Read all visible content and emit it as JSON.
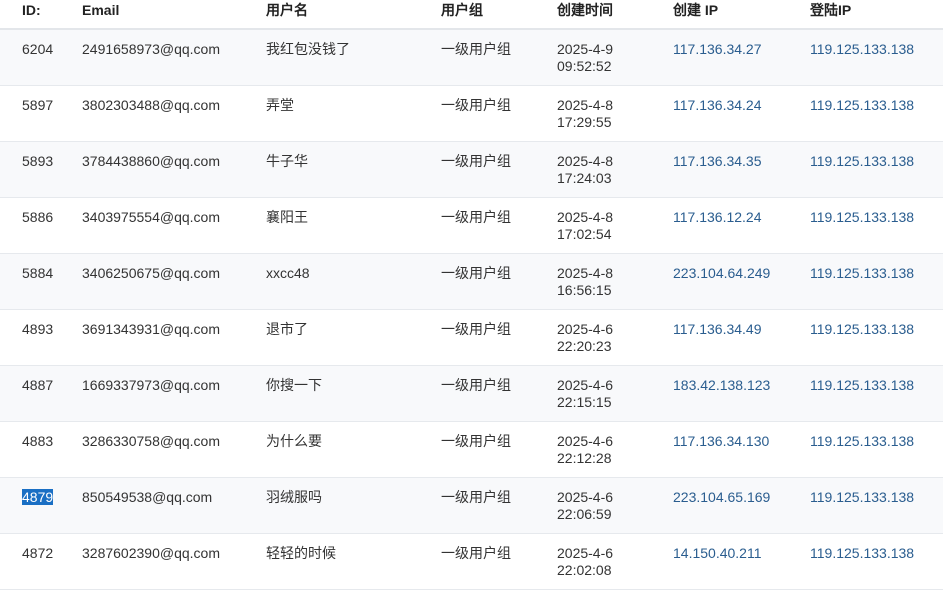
{
  "table": {
    "headers": {
      "id": "ID:",
      "email": "Email",
      "username": "用户名",
      "group": "用户组",
      "created_time": "创建时间",
      "created_ip": "创建 IP",
      "login_ip": "登陆IP"
    },
    "rows": [
      {
        "id": "6204",
        "email": "2491658973@qq.com",
        "username": "我红包没钱了",
        "group": "一级用户组",
        "date": "2025-4-9",
        "time": "09:52:52",
        "created_ip": "117.136.34.27",
        "login_ip": "119.125.133.138"
      },
      {
        "id": "5897",
        "email": "3802303488@qq.com",
        "username": "弄堂",
        "group": "一级用户组",
        "date": "2025-4-8",
        "time": "17:29:55",
        "created_ip": "117.136.34.24",
        "login_ip": "119.125.133.138"
      },
      {
        "id": "5893",
        "email": "3784438860@qq.com",
        "username": "牛子华",
        "group": "一级用户组",
        "date": "2025-4-8",
        "time": "17:24:03",
        "created_ip": "117.136.34.35",
        "login_ip": "119.125.133.138"
      },
      {
        "id": "5886",
        "email": "3403975554@qq.com",
        "username": "襄阳王",
        "group": "一级用户组",
        "date": "2025-4-8",
        "time": "17:02:54",
        "created_ip": "117.136.12.24",
        "login_ip": "119.125.133.138"
      },
      {
        "id": "5884",
        "email": "3406250675@qq.com",
        "username": "xxcc48",
        "group": "一级用户组",
        "date": "2025-4-8",
        "time": "16:56:15",
        "created_ip": "223.104.64.249",
        "login_ip": "119.125.133.138"
      },
      {
        "id": "4893",
        "email": "3691343931@qq.com",
        "username": "退市了",
        "group": "一级用户组",
        "date": "2025-4-6",
        "time": "22:20:23",
        "created_ip": "117.136.34.49",
        "login_ip": "119.125.133.138"
      },
      {
        "id": "4887",
        "email": "1669337973@qq.com",
        "username": "你搜一下",
        "group": "一级用户组",
        "date": "2025-4-6",
        "time": "22:15:15",
        "created_ip": "183.42.138.123",
        "login_ip": "119.125.133.138"
      },
      {
        "id": "4883",
        "email": "3286330758@qq.com",
        "username": "为什么要",
        "group": "一级用户组",
        "date": "2025-4-6",
        "time": "22:12:28",
        "created_ip": "117.136.34.130",
        "login_ip": "119.125.133.138"
      },
      {
        "id": "4879",
        "email": "850549538@qq.com",
        "username": "羽绒服吗",
        "group": "一级用户组",
        "date": "2025-4-6",
        "time": "22:06:59",
        "created_ip": "223.104.65.169",
        "login_ip": "119.125.133.138",
        "selected": true
      },
      {
        "id": "4872",
        "email": "3287602390@qq.com",
        "username": "轻轻的时候",
        "group": "一级用户组",
        "date": "2025-4-6",
        "time": "22:02:08",
        "created_ip": "14.150.40.211",
        "login_ip": "119.125.133.138"
      }
    ]
  },
  "colors": {
    "header_text": "#222222",
    "body_text": "#333333",
    "ip_link": "#2a5d8f",
    "selection": "#1a6fc4",
    "row_alt": "#f8f9fb"
  }
}
